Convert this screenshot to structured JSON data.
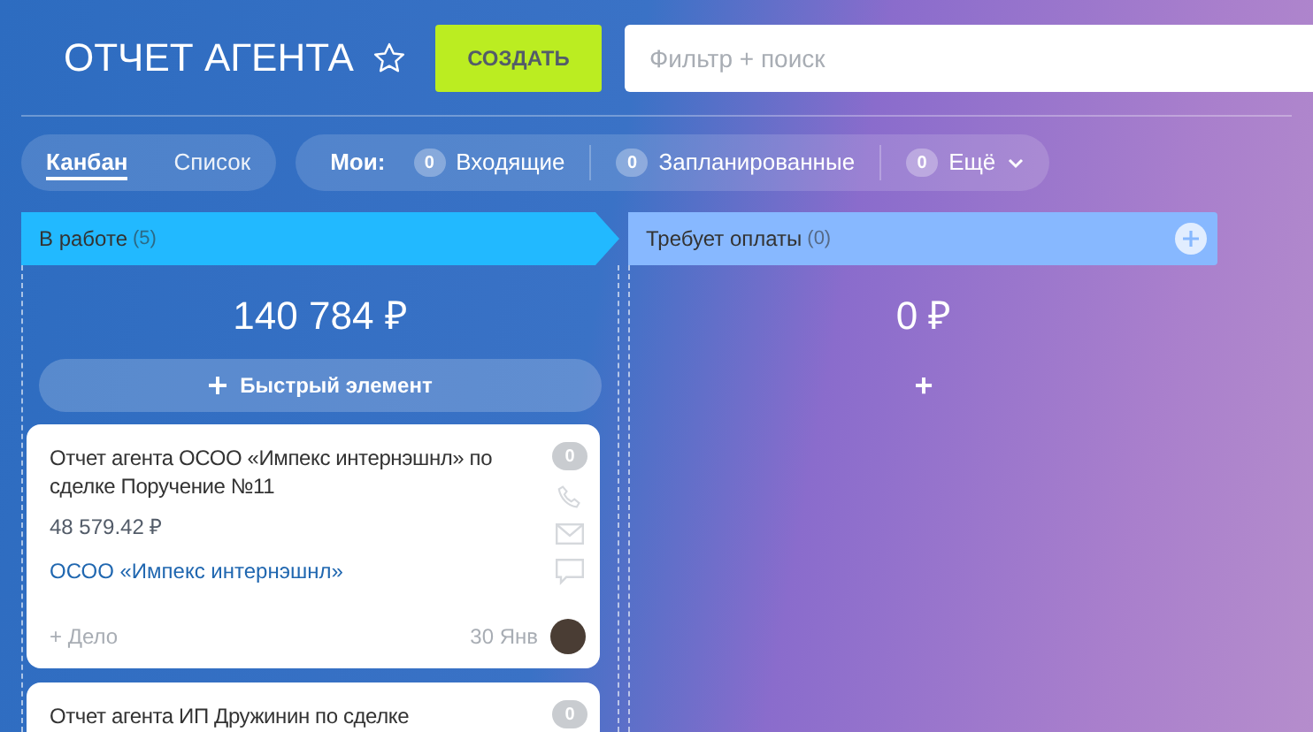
{
  "header": {
    "title": "ОТЧЕТ АГЕНТА",
    "starred": false,
    "create_button": "СОЗДАТЬ",
    "search": {
      "placeholder": "Фильтр + поиск"
    }
  },
  "views": [
    {
      "label": "Канбан",
      "selected": true
    },
    {
      "label": "Список",
      "selected": false
    }
  ],
  "my_filters": {
    "label": "Мои:",
    "items": [
      {
        "count": "0",
        "label": "Входящие",
        "dropdown": false
      },
      {
        "count": "0",
        "label": "Запланированные",
        "dropdown": false
      },
      {
        "count": "0",
        "label": "Ещё",
        "dropdown": true
      }
    ]
  },
  "columns": [
    {
      "name": "В работе",
      "count": "(5)",
      "color": "#22b9ff",
      "sum": "140 784 ₽",
      "quick_add": "Быстрый элемент",
      "cards": [
        {
          "title": "Отчет агента ОСОО «Импекс интернэшнл» по сделке Поручение №11",
          "counter": "0",
          "amount": "48 579.42 ₽",
          "client": "ОСОО «Импекс интернэшнл»",
          "add_activity": "+ Дело",
          "date": "30 Янв"
        },
        {
          "title": "Отчет агента ИП Дружинин по сделке",
          "counter": "0"
        }
      ]
    },
    {
      "name": "Требует оплаты",
      "count": "(0)",
      "color": "#87b8ff",
      "sum": "0 ₽",
      "add": "+"
    }
  ]
}
